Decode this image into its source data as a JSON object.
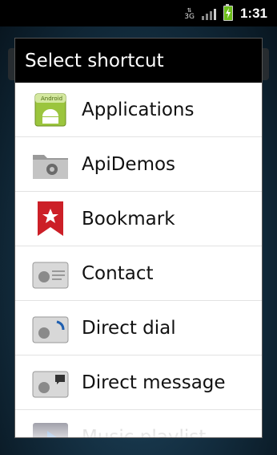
{
  "status_bar": {
    "network_type": "3G",
    "time": "1:31"
  },
  "dialog": {
    "title": "Select shortcut",
    "items": [
      {
        "label": "Applications",
        "icon": "android-app-icon"
      },
      {
        "label": "ApiDemos",
        "icon": "folder-gear-icon"
      },
      {
        "label": "Bookmark",
        "icon": "bookmark-star-icon"
      },
      {
        "label": "Contact",
        "icon": "contact-card-icon"
      },
      {
        "label": "Direct dial",
        "icon": "direct-dial-icon"
      },
      {
        "label": "Direct message",
        "icon": "direct-message-icon"
      },
      {
        "label": "Music playlist",
        "icon": "music-playlist-icon"
      }
    ]
  },
  "colors": {
    "title_bar": "#000000",
    "dialog_bg": "#ffffff",
    "bookmark_red": "#cc1f27",
    "android_green": "#a4c639"
  }
}
